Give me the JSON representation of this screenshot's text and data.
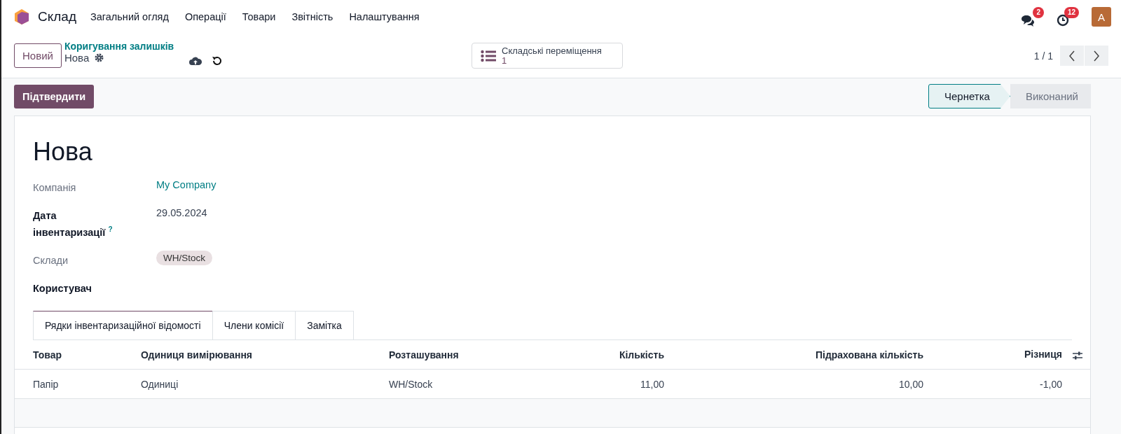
{
  "navbar": {
    "app_name": "Склад",
    "menu": [
      "Загальний огляд",
      "Операції",
      "Товари",
      "Звітність",
      "Налаштування"
    ],
    "messages_count": "2",
    "activities_count": "12",
    "avatar_letter": "A"
  },
  "control_panel": {
    "new_button": "Новий",
    "breadcrumb": "Коригування залишків",
    "record_name": "Нова",
    "smart_button": {
      "label": "Складські переміщення",
      "count": "1"
    },
    "pager": "1 / 1"
  },
  "action_bar": {
    "confirm_button": "Підтвердити",
    "stages": [
      {
        "label": "Чернетка",
        "selected": true
      },
      {
        "label": "Виконаний",
        "selected": false
      }
    ]
  },
  "form": {
    "title": "Нова",
    "fields": [
      {
        "label": "Компанія",
        "kind": "link",
        "value": "My Company",
        "required": false
      },
      {
        "label": "Дата інвентаризації",
        "kind": "text",
        "value": "29.05.2024",
        "required": true,
        "help": true
      },
      {
        "label": "Склади",
        "kind": "tag",
        "value": "WH/Stock",
        "required": false
      },
      {
        "label": "Користувач",
        "required": true
      }
    ],
    "help_mark": "?",
    "tabs": [
      {
        "label": "Рядки інвентаризаційної відомості",
        "selected": true
      },
      {
        "label": "Члени комісії",
        "selected": false
      },
      {
        "label": "Замітка",
        "selected": false
      }
    ],
    "table": {
      "columns": [
        "Товар",
        "Одиниця вимірювання",
        "Розташування",
        "Кількість",
        "Підрахована кількість",
        "Різниця"
      ],
      "rows": [
        [
          "Папір",
          "Одиниці",
          "WH/Stock",
          "11,00",
          "10,00",
          "-1,00"
        ]
      ]
    }
  }
}
